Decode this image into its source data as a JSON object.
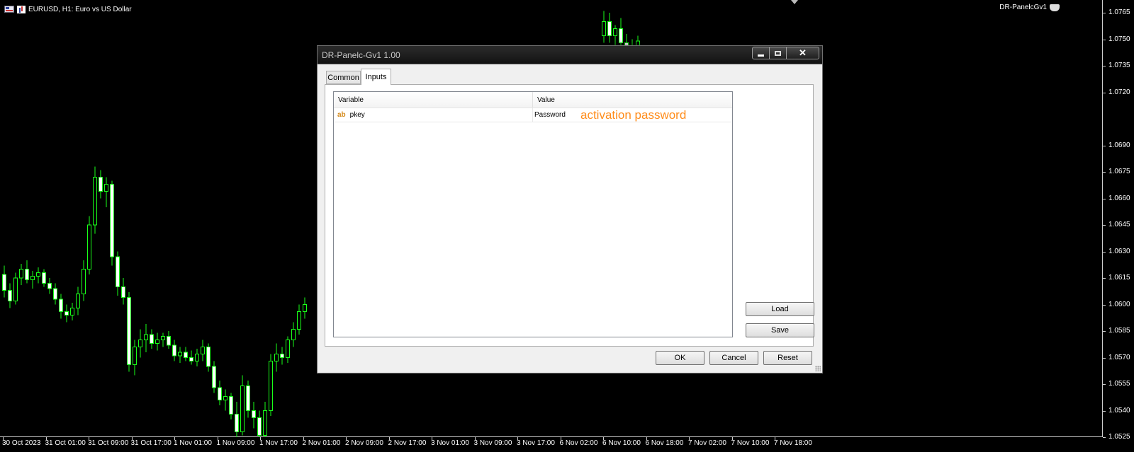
{
  "chart": {
    "symbol_info": "EURUSD, H1:  Euro vs US Dollar",
    "ea_name": "DR-PanelcGv1",
    "colors": {
      "background": "#000000",
      "candle": "#19ff19",
      "axis_text": "#ffffff"
    },
    "price_levels": [
      "1.0765",
      "1.0750",
      "1.0735",
      "1.0720",
      "1.0690",
      "1.0675",
      "1.0660",
      "1.0645",
      "1.0630",
      "1.0615",
      "1.0600",
      "1.0585",
      "1.0570",
      "1.0555",
      "1.0540",
      "1.0525"
    ],
    "time_labels": [
      "30 Oct 2023",
      "31 Oct 01:00",
      "31 Oct 09:00",
      "31 Oct 17:00",
      "1 Nov 01:00",
      "1 Nov 09:00",
      "1 Nov 17:00",
      "2 Nov 01:00",
      "2 Nov 09:00",
      "2 Nov 17:00",
      "3 Nov 01:00",
      "3 Nov 09:00",
      "3 Nov 17:00",
      "6 Nov 02:00",
      "6 Nov 10:00",
      "6 Nov 18:00",
      "7 Nov 02:00",
      "7 Nov 10:00",
      "7 Nov 18:00"
    ],
    "candles": [
      [
        1.0617,
        1.0622,
        1.0604,
        1.0608
      ],
      [
        1.0608,
        1.0612,
        1.0598,
        1.0602
      ],
      [
        1.0602,
        1.0618,
        1.06,
        1.0615
      ],
      [
        1.0615,
        1.0623,
        1.0611,
        1.062
      ],
      [
        1.062,
        1.0625,
        1.0612,
        1.0614
      ],
      [
        1.0614,
        1.0619,
        1.0609,
        1.0616
      ],
      [
        1.0616,
        1.0621,
        1.0612,
        1.0618
      ],
      [
        1.0618,
        1.062,
        1.061,
        1.0612
      ],
      [
        1.0612,
        1.0615,
        1.0606,
        1.0609
      ],
      [
        1.0609,
        1.0612,
        1.06,
        1.0603
      ],
      [
        1.0603,
        1.0606,
        1.0592,
        1.0596
      ],
      [
        1.0596,
        1.06,
        1.059,
        1.0594
      ],
      [
        1.0594,
        1.0601,
        1.0591,
        1.0598
      ],
      [
        1.0598,
        1.061,
        1.0594,
        1.0606
      ],
      [
        1.0606,
        1.0625,
        1.0602,
        1.062
      ],
      [
        1.062,
        1.065,
        1.0617,
        1.0645
      ],
      [
        1.0645,
        1.0678,
        1.064,
        1.0672
      ],
      [
        1.0672,
        1.0676,
        1.066,
        1.0664
      ],
      [
        1.0664,
        1.0672,
        1.0655,
        1.0668
      ],
      [
        1.0668,
        1.067,
        1.0622,
        1.0627
      ],
      [
        1.0627,
        1.063,
        1.0605,
        1.061
      ],
      [
        1.061,
        1.0615,
        1.06,
        1.0604
      ],
      [
        1.0604,
        1.0607,
        1.0562,
        1.0566
      ],
      [
        1.0566,
        1.058,
        1.056,
        1.0576
      ],
      [
        1.0576,
        1.0586,
        1.057,
        1.058
      ],
      [
        1.058,
        1.0589,
        1.0573,
        1.0583
      ],
      [
        1.0583,
        1.0586,
        1.0575,
        1.0578
      ],
      [
        1.0578,
        1.0584,
        1.0574,
        1.058
      ],
      [
        1.058,
        1.0584,
        1.0576,
        1.0582
      ],
      [
        1.0582,
        1.0585,
        1.0575,
        1.0577
      ],
      [
        1.0577,
        1.058,
        1.0568,
        1.0571
      ],
      [
        1.0571,
        1.0576,
        1.0567,
        1.0573
      ],
      [
        1.0573,
        1.0576,
        1.0568,
        1.057
      ],
      [
        1.057,
        1.0574,
        1.0566,
        1.0568
      ],
      [
        1.0568,
        1.0575,
        1.0565,
        1.0572
      ],
      [
        1.0572,
        1.058,
        1.0568,
        1.0576
      ],
      [
        1.0576,
        1.0578,
        1.0562,
        1.0565
      ],
      [
        1.0565,
        1.0568,
        1.055,
        1.0553
      ],
      [
        1.0553,
        1.0557,
        1.0543,
        1.0546
      ],
      [
        1.0546,
        1.0552,
        1.054,
        1.0548
      ],
      [
        1.0548,
        1.055,
        1.0535,
        1.0538
      ],
      [
        1.0538,
        1.0545,
        1.0522,
        1.0528
      ],
      [
        1.0528,
        1.056,
        1.0526,
        1.0554
      ],
      [
        1.0554,
        1.0557,
        1.0536,
        1.054
      ],
      [
        1.054,
        1.0545,
        1.053,
        1.0536
      ],
      [
        1.0536,
        1.054,
        1.052,
        1.0526
      ],
      [
        1.0526,
        1.0545,
        1.0518,
        1.054
      ],
      [
        1.054,
        1.0572,
        1.0537,
        1.0568
      ],
      [
        1.0568,
        1.0578,
        1.0562,
        1.0572
      ],
      [
        1.0572,
        1.0576,
        1.0566,
        1.057
      ],
      [
        1.057,
        1.0582,
        1.0567,
        1.058
      ],
      [
        1.058,
        1.059,
        1.0576,
        1.0586
      ],
      [
        1.0586,
        1.06,
        1.0583,
        1.0596
      ],
      [
        1.0596,
        1.0604,
        1.0592,
        1.06
      ]
    ],
    "candles_top": [
      [
        1.0752,
        1.0766,
        1.0748,
        1.076
      ],
      [
        1.076,
        1.0765,
        1.0748,
        1.0752
      ],
      [
        1.0752,
        1.0758,
        1.0744,
        1.0756
      ],
      [
        1.0756,
        1.0762,
        1.0745,
        1.0748
      ],
      [
        1.0748,
        1.0753,
        1.074,
        1.0745
      ],
      [
        1.0745,
        1.075,
        1.0738,
        1.0742
      ],
      [
        1.0742,
        1.0752,
        1.0739,
        1.0749
      ]
    ]
  },
  "dialog": {
    "title": "DR-Panelc-Gv1 1.00",
    "close_glyph": "✕",
    "tabs": [
      {
        "label": "Common"
      },
      {
        "label": "Inputs"
      }
    ],
    "table": {
      "headers": {
        "variable": "Variable",
        "value": "Value"
      },
      "rows": [
        {
          "type_icon": "ab",
          "variable": "pkey",
          "value": "Password"
        }
      ]
    },
    "annotation": "activation password",
    "annotation_color": "#ff8c1a",
    "buttons": {
      "load": "Load",
      "save": "Save",
      "ok": "OK",
      "cancel": "Cancel",
      "reset": "Reset"
    }
  }
}
